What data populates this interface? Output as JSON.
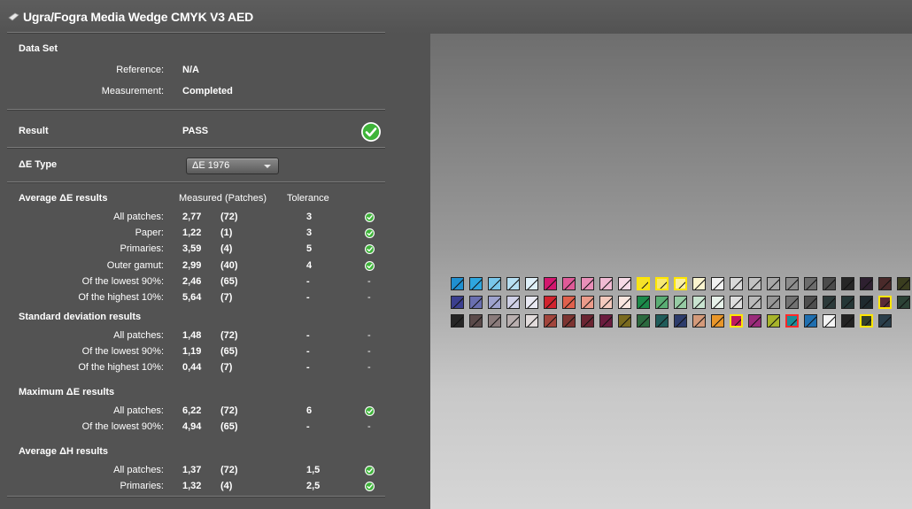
{
  "window": {
    "title": "Ugra/Fogra Media Wedge CMYK V3 AED"
  },
  "dataset": {
    "header": "Data Set",
    "reference_label": "Reference:",
    "reference_value": "N/A",
    "measurement_label": "Measurement:",
    "measurement_value": "Completed"
  },
  "result": {
    "label": "Result",
    "value": "PASS"
  },
  "de_type": {
    "label": "ΔE Type",
    "selected": "ΔE 1976"
  },
  "columns": {
    "measured": "Measured (Patches)",
    "tolerance": "Tolerance"
  },
  "sections": [
    {
      "header": "Average ΔE results",
      "rows": [
        {
          "label": "All patches:",
          "value": "2,77",
          "patches": "(72)",
          "tolerance": "3",
          "status": "pass"
        },
        {
          "label": "Paper:",
          "value": "1,22",
          "patches": "(1)",
          "tolerance": "3",
          "status": "pass"
        },
        {
          "label": "Primaries:",
          "value": "3,59",
          "patches": "(4)",
          "tolerance": "5",
          "status": "pass"
        },
        {
          "label": "Outer gamut:",
          "value": "2,99",
          "patches": "(40)",
          "tolerance": "4",
          "status": "pass"
        },
        {
          "label": "Of the lowest 90%:",
          "value": "2,46",
          "patches": "(65)",
          "tolerance": "-",
          "status": "-"
        },
        {
          "label": "Of the highest 10%:",
          "value": "5,64",
          "patches": "(7)",
          "tolerance": "-",
          "status": "-"
        }
      ]
    },
    {
      "header": "Standard deviation results",
      "rows": [
        {
          "label": "All patches:",
          "value": "1,48",
          "patches": "(72)",
          "tolerance": "-",
          "status": "-"
        },
        {
          "label": "Of the lowest 90%:",
          "value": "1,19",
          "patches": "(65)",
          "tolerance": "-",
          "status": "-"
        },
        {
          "label": "Of the highest 10%:",
          "value": "0,44",
          "patches": "(7)",
          "tolerance": "-",
          "status": "-"
        }
      ]
    },
    {
      "header": "Maximum ΔE results",
      "rows": [
        {
          "label": "All patches:",
          "value": "6,22",
          "patches": "(72)",
          "tolerance": "6",
          "status": "pass"
        },
        {
          "label": "Of the lowest 90%:",
          "value": "4,94",
          "patches": "(65)",
          "tolerance": "-",
          "status": "-"
        }
      ]
    },
    {
      "header": "Average ΔH results",
      "rows": [
        {
          "label": "All patches:",
          "value": "1,37",
          "patches": "(72)",
          "tolerance": "1,5",
          "status": "pass"
        },
        {
          "label": "Primaries:",
          "value": "1,32",
          "patches": "(4)",
          "tolerance": "2,5",
          "status": "pass"
        }
      ]
    }
  ],
  "colors": {
    "pass_green": "#3fb43a",
    "highlight_yellow": "#ffe600",
    "highlight_red": "#ff2a2a"
  },
  "wedge": {
    "rows": [
      {
        "patches": [
          {
            "c": "#1f8fd0"
          },
          {
            "c": "#2ea6de"
          },
          {
            "c": "#79c6ea"
          },
          {
            "c": "#b6dff2"
          },
          {
            "c": "#dff0f9"
          },
          {
            "c": "#d3166e"
          },
          {
            "c": "#df5a98"
          },
          {
            "c": "#e98fb8"
          },
          {
            "c": "#f1bad3"
          },
          {
            "c": "#f7dbe7"
          },
          {
            "c": "#f5e12a",
            "hl": "y"
          },
          {
            "c": "#f7e874",
            "hl": "y"
          },
          {
            "c": "#f9efa5",
            "hl": "y"
          },
          {
            "c": "#fbf5cf"
          },
          {
            "c": "#f2f2f2"
          },
          {
            "c": "#d9d9d9"
          },
          {
            "c": "#c2c2c2"
          },
          {
            "c": "#a8a8a8"
          },
          {
            "c": "#8c8c8c"
          },
          {
            "c": "#6c6c6c"
          },
          {
            "c": "#4b4b4b"
          },
          {
            "c": "#262626"
          },
          {
            "c": "#2e2030"
          },
          {
            "c": "#4a2a2a"
          },
          {
            "c": "#3a3d1f"
          }
        ]
      },
      {
        "patches": [
          {
            "c": "#3b3f8f"
          },
          {
            "c": "#6a6fb0"
          },
          {
            "c": "#9ea2cd"
          },
          {
            "c": "#cfd0e6"
          },
          {
            "c": "#e9e9f3"
          },
          {
            "c": "#d1232e"
          },
          {
            "c": "#e0604c"
          },
          {
            "c": "#eb9b8a"
          },
          {
            "c": "#f3c9bd"
          },
          {
            "c": "#f9e6df"
          },
          {
            "c": "#1c8a4a"
          },
          {
            "c": "#5aae74"
          },
          {
            "c": "#96cba4"
          },
          {
            "c": "#c9e4d0"
          },
          {
            "c": "#e7f2ea"
          },
          {
            "c": "#dedede"
          },
          {
            "c": "#bababa"
          },
          {
            "c": "#969696"
          },
          {
            "c": "#727272"
          },
          {
            "c": "#4e4e4e"
          },
          {
            "c": "#2c3a3a"
          },
          {
            "c": "#243636"
          },
          {
            "c": "#1f2a2e"
          },
          {
            "c": "#5a2a36",
            "hl": "y"
          },
          {
            "c": "#2c4236"
          }
        ]
      },
      {
        "patches": [
          {
            "c": "#262626"
          },
          {
            "c": "#5b4a4a"
          },
          {
            "c": "#8a7b7b"
          },
          {
            "c": "#b9afaf"
          },
          {
            "c": "#e2dcdc"
          },
          {
            "c": "#a2453c"
          },
          {
            "c": "#7d3431"
          },
          {
            "c": "#6b2532"
          },
          {
            "c": "#6b1c3e"
          },
          {
            "c": "#7a6a1e"
          },
          {
            "c": "#2c6a3f"
          },
          {
            "c": "#1f5c5a"
          },
          {
            "c": "#2d3c6c"
          },
          {
            "c": "#d49a7a"
          },
          {
            "c": "#e8962a"
          },
          {
            "c": "#c0185f",
            "hl": "y"
          },
          {
            "c": "#9a2b7a"
          },
          {
            "c": "#a7b42a"
          },
          {
            "c": "#1a8f9a",
            "hl": "r"
          },
          {
            "c": "#1f6fb0"
          },
          {
            "c": "#f4f4f4"
          },
          {
            "c": "#222222"
          },
          {
            "c": "#34402a",
            "hl": "y"
          },
          {
            "c": "#2a3e4a"
          }
        ]
      }
    ]
  }
}
